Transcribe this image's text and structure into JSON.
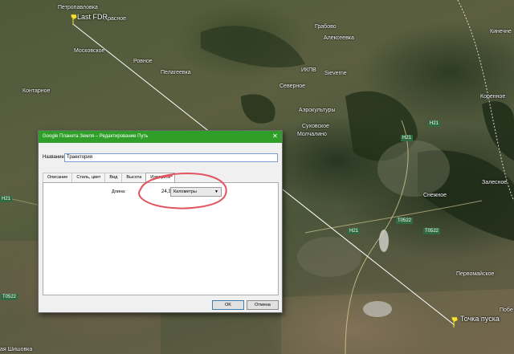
{
  "map": {
    "places": [
      {
        "id": "petropavlovka",
        "label": "Петропавловка"
      },
      {
        "id": "krasnoe",
        "label": "Красное"
      },
      {
        "id": "moskovskoe",
        "label": "Московское"
      },
      {
        "id": "kontarnoe",
        "label": "Контарное"
      },
      {
        "id": "rovnoe",
        "label": "Ровное"
      },
      {
        "id": "pelageevka",
        "label": "Пелагеевка"
      },
      {
        "id": "grabovo",
        "label": "Грабово"
      },
      {
        "id": "alekseevka",
        "label": "Алексеевка"
      },
      {
        "id": "severnoe",
        "label": "Северное"
      },
      {
        "id": "sieverne",
        "label": "Sieverne"
      },
      {
        "id": "ikpv",
        "label": "ИКПВ"
      },
      {
        "id": "aerokultury",
        "label": "Аэрокультуры"
      },
      {
        "id": "sukhovskoe",
        "label": "Суховское"
      },
      {
        "id": "molchalino",
        "label": "Молчалино"
      },
      {
        "id": "snezhnoe",
        "label": "Снежное"
      },
      {
        "id": "zalesnoe",
        "label": "Залесное"
      },
      {
        "id": "korennoe",
        "label": "Коренное"
      },
      {
        "id": "pervomayskoe",
        "label": "Первомайское"
      },
      {
        "id": "kinechne",
        "label": "Кинечне"
      },
      {
        "id": "pob",
        "label": "Побе"
      },
      {
        "id": "shishovka",
        "label": "ая Шишовка"
      }
    ],
    "roads": {
      "h21": "H21",
      "t0522": "T0522"
    },
    "pins": {
      "start": "Last FDR",
      "end": "Точка пуска"
    }
  },
  "dialog": {
    "title": "Google Планета Земля – Редактирование Путь",
    "close_glyph": "✕",
    "name_label": "Название:",
    "name_value": "Траектория",
    "tabs": [
      "Описание",
      "Стиль, цвет",
      "Вид",
      "Высота",
      "Измерить"
    ],
    "active_tab": "Измерить",
    "length_label": "Длина:",
    "length_value": "24,3",
    "units_value": "Километры",
    "ok_label": "OK",
    "cancel_label": "Отмена"
  },
  "colors": {
    "titlebar": "#2f9f2a",
    "annotation_circle": "#e0555f",
    "trajectory_line": "#ffffff"
  }
}
